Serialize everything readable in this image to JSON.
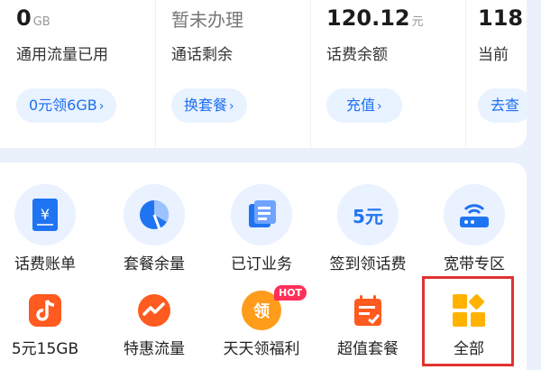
{
  "stats": [
    {
      "value": "0",
      "unit": "GB",
      "label": "通用流量已用",
      "button": "0元领6GB"
    },
    {
      "value": "暂未办理",
      "unit": "",
      "label": "通话剩余",
      "button": "换套餐"
    },
    {
      "value": "120.12",
      "unit": "元",
      "label": "话费余额",
      "button": "充值"
    },
    {
      "value": "118",
      "unit": "",
      "label": "当前",
      "button": "去查"
    }
  ],
  "services": [
    {
      "label": "话费账单",
      "icon": "bill-icon"
    },
    {
      "label": "套餐余量",
      "icon": "pie-chart-icon"
    },
    {
      "label": "已订业务",
      "icon": "subscriptions-icon"
    },
    {
      "label": "签到领话费",
      "icon": "checkin-5yuan-icon",
      "icon_text": "5元"
    },
    {
      "label": "宽带专区",
      "icon": "router-icon"
    },
    {
      "label": "5元15GB",
      "icon": "music-note-icon"
    },
    {
      "label": "特惠流量",
      "icon": "trend-icon"
    },
    {
      "label": "天天领福利",
      "icon": "daily-reward-icon",
      "badge": "HOT",
      "icon_text": "领"
    },
    {
      "label": "超值套餐",
      "icon": "calendar-check-icon"
    },
    {
      "label": "全部",
      "icon": "all-services-icon"
    }
  ],
  "colors": {
    "accent": "#1d6ff3",
    "highlight": "#e0332f",
    "hot": "#ff2f5a",
    "orange": "#ff5a1f"
  }
}
